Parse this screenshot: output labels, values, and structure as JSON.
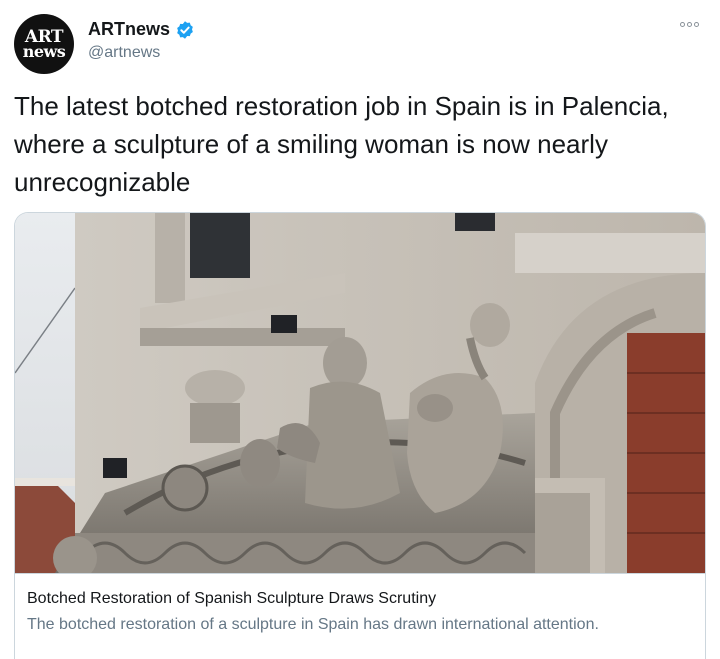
{
  "account": {
    "avatar_line1": "ART",
    "avatar_line2": "news",
    "display_name": "ARTnews",
    "handle": "@artnews",
    "verified_icon": "verified-badge-icon",
    "more_icon": "more-options-icon"
  },
  "tweet": {
    "text": "The latest botched restoration job in Spain is in Palencia, where a sculpture of a smiling woman is now nearly unrecognizable"
  },
  "card": {
    "title": "Botched Restoration of Spanish Sculpture Draws Scrutiny",
    "description": "The botched restoration of a sculpture in Spain has drawn international attention."
  },
  "colors": {
    "accent": "#1da1f2",
    "text_primary": "#14171a",
    "text_secondary": "#657786",
    "border": "#ccd6dd"
  }
}
